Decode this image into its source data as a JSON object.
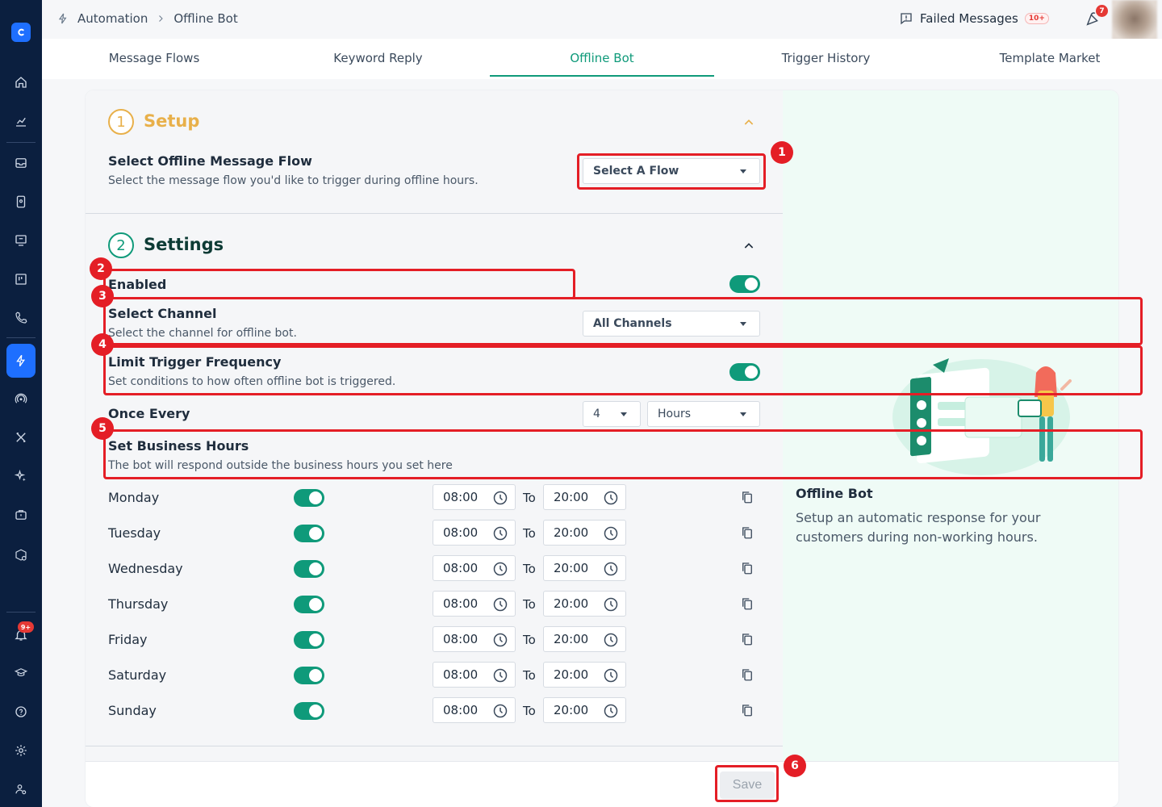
{
  "breadcrumb": {
    "parent": "Automation",
    "current": "Offline Bot"
  },
  "header": {
    "failed_messages": "Failed Messages",
    "failed_badge": "10+",
    "notif_badge": "7"
  },
  "sidebar": {
    "badge": "9+"
  },
  "tabs": [
    {
      "label": "Message Flows"
    },
    {
      "label": "Keyword Reply"
    },
    {
      "label": "Offline Bot"
    },
    {
      "label": "Trigger History"
    },
    {
      "label": "Template Market"
    }
  ],
  "setup": {
    "step": "1",
    "title": "Setup",
    "flow_label": "Select Offline Message Flow",
    "flow_desc": "Select the message flow you'd like to trigger during offline hours.",
    "flow_select": "Select A Flow"
  },
  "settings": {
    "step": "2",
    "title": "Settings",
    "enabled_label": "Enabled",
    "channel_label": "Select Channel",
    "channel_desc": "Select the channel for offline bot.",
    "channel_select": "All Channels",
    "limit_label": "Limit Trigger Frequency",
    "limit_desc": "Set conditions to how often offline bot is triggered.",
    "once_label": "Once Every",
    "once_value": "4",
    "once_unit": "Hours",
    "hours_label": "Set Business Hours",
    "hours_desc": "The bot will respond outside the business hours you set here",
    "to_label": "To",
    "days": [
      {
        "name": "Monday",
        "start": "08:00",
        "end": "20:00"
      },
      {
        "name": "Tuesday",
        "start": "08:00",
        "end": "20:00"
      },
      {
        "name": "Wednesday",
        "start": "08:00",
        "end": "20:00"
      },
      {
        "name": "Thursday",
        "start": "08:00",
        "end": "20:00"
      },
      {
        "name": "Friday",
        "start": "08:00",
        "end": "20:00"
      },
      {
        "name": "Saturday",
        "start": "08:00",
        "end": "20:00"
      },
      {
        "name": "Sunday",
        "start": "08:00",
        "end": "20:00"
      }
    ]
  },
  "info": {
    "title": "Offline Bot",
    "desc": "Setup an automatic response for your customers during non-working hours."
  },
  "footer": {
    "save_label": "Save"
  },
  "annotations": [
    "1",
    "2",
    "3",
    "4",
    "5",
    "6"
  ],
  "colors": {
    "accent": "#0f9a7a",
    "sidebar": "#0b1f3f",
    "setup": "#e8b04a",
    "annotation": "#e41e26"
  }
}
